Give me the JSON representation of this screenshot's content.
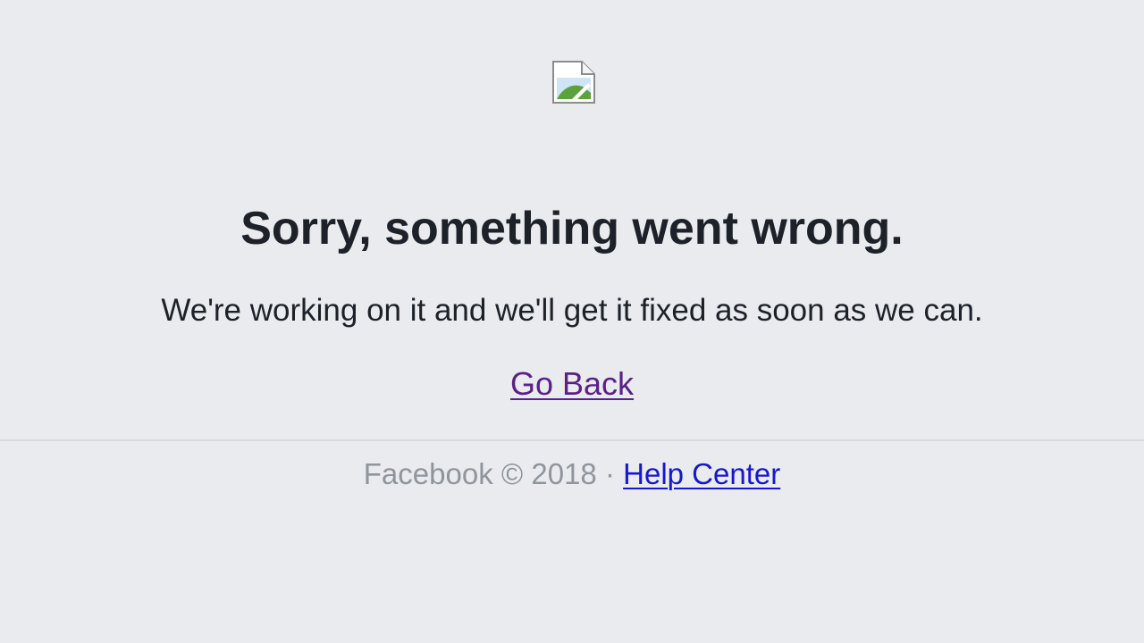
{
  "error": {
    "title": "Sorry, something went wrong.",
    "message": "We're working on it and we'll get it fixed as soon as we can.",
    "go_back_label": "Go Back"
  },
  "footer": {
    "brand": "Facebook",
    "copyright_symbol": "©",
    "year": "2018",
    "separator": "·",
    "help_center_label": "Help Center"
  },
  "image": {
    "icon": "broken-image-icon"
  },
  "colors": {
    "background": "#e9ebee",
    "text": "#1d2129",
    "visited_link": "#5b2186",
    "link": "#1717cc",
    "footer_text": "#90949c"
  }
}
